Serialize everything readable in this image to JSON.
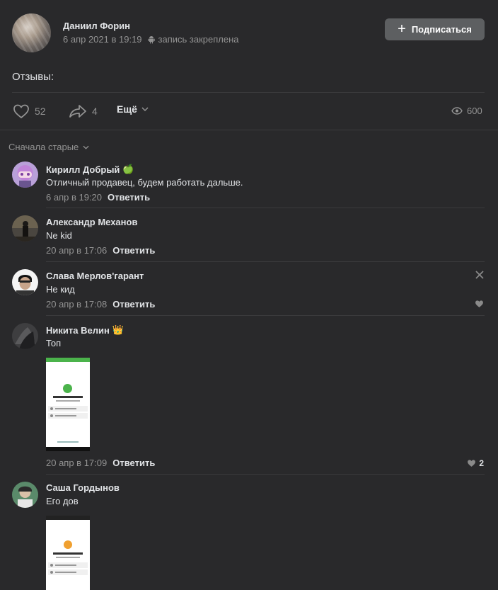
{
  "post": {
    "author": "Даниил Форин",
    "date": "6 апр 2021 в 19:19",
    "pinned_label": "запись закреплена",
    "subscribe_label": "Подписаться",
    "text": "Отзывы:",
    "likes": "52",
    "shares": "4",
    "more_label": "Ещё",
    "views": "600"
  },
  "comments_section": {
    "sort_label": "Сначала старые"
  },
  "comments": [
    {
      "name": "Кирилл Добрый",
      "badge": "🍏",
      "text": "Отличный продавец, будем работать дальше.",
      "date": "6 апр в 19:20",
      "reply": "Ответить"
    },
    {
      "name": "Александр Механов",
      "text": "Ne kid",
      "date": "20 апр в 17:06",
      "reply": "Ответить"
    },
    {
      "name": "Слава Мерлов'гарант",
      "text": "Не кид",
      "date": "20 апр в 17:08",
      "reply": "Ответить"
    },
    {
      "name": "Никита Велин",
      "badge": "👑",
      "text": "Топ",
      "date": "20 апр в 17:09",
      "reply": "Ответить",
      "likes": "2"
    },
    {
      "name": "Саша Гордынов",
      "text": "Его дов"
    }
  ],
  "colors": {
    "background": "#29292b",
    "text": "#e1e3e6",
    "secondary": "#939393",
    "button": "#5d5f61",
    "accent_green": "#4bb34b"
  }
}
